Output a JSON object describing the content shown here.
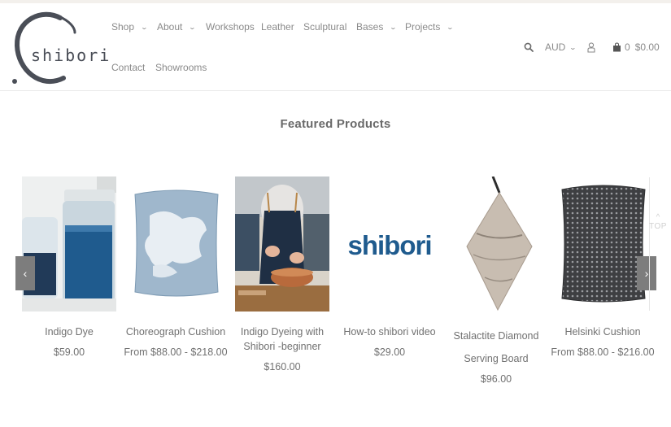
{
  "brand": {
    "logo_text": "shibori"
  },
  "nav": {
    "items": [
      {
        "label": "Shop",
        "has_dropdown": true
      },
      {
        "label": "About",
        "has_dropdown": true
      },
      {
        "label": "Workshops",
        "has_dropdown": false
      },
      {
        "label": "Leather",
        "has_dropdown": false
      },
      {
        "label": "Sculptural",
        "has_dropdown": false
      },
      {
        "label": "Bases",
        "has_dropdown": true
      },
      {
        "label": "Projects",
        "has_dropdown": true
      },
      {
        "label": "Contact",
        "has_dropdown": false
      },
      {
        "label": "Showrooms",
        "has_dropdown": false
      }
    ]
  },
  "utility": {
    "currency": "AUD",
    "cart_count": "0",
    "cart_total": "$0.00",
    "icons": [
      "search-icon",
      "chevron-down-icon",
      "user-icon",
      "bag-icon"
    ]
  },
  "featured": {
    "title": "Featured Products",
    "products": [
      {
        "name": "Indigo Dye",
        "price": "$59.00"
      },
      {
        "name": "Choreograph Cushion",
        "price": "From $88.00 - $218.00"
      },
      {
        "name": "Indigo Dyeing with Shibori -beginner",
        "price": "$160.00"
      },
      {
        "name": "How-to shibori video",
        "price": "$29.00",
        "image_text": "shibori"
      },
      {
        "name": "Stalactite Diamond Serving Board",
        "price": "$96.00"
      },
      {
        "name": "Helsinki Cushion",
        "price": "From $88.00 - $216.00"
      }
    ],
    "prev_arrow": "‹",
    "next_arrow": "›"
  },
  "back_to_top": "TOP",
  "colors": {
    "indigo": "#1f5b8e",
    "arrow_bg": "#7d7d7d",
    "text": "#707070"
  }
}
